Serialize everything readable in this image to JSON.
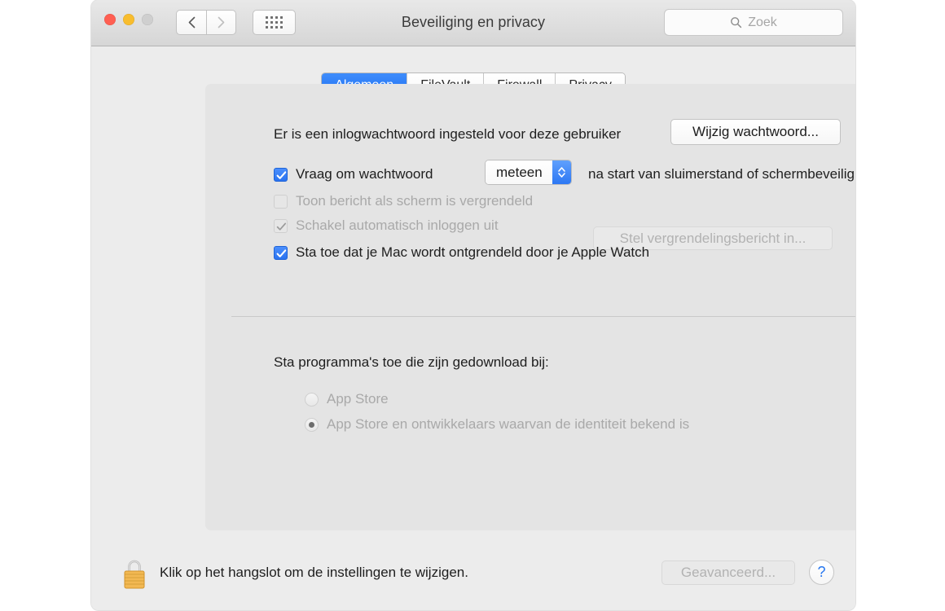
{
  "window": {
    "title": "Beveiliging en privacy",
    "traffic_lights": {
      "close_color": "#ff5f52",
      "minimize_color": "#f8bd2e",
      "zoom_color": "#cfcfcf"
    },
    "nav": {
      "back_icon": "chevron-left-icon",
      "forward_icon": "chevron-right-icon",
      "grid_icon": "grid-view-icon"
    },
    "search": {
      "placeholder": "Zoek",
      "value": "",
      "icon": "search-icon"
    }
  },
  "tabs": [
    {
      "label": "Algemeen",
      "active": true
    },
    {
      "label": "FileVault",
      "active": false
    },
    {
      "label": "Firewall",
      "active": false
    },
    {
      "label": "Privacy",
      "active": false
    }
  ],
  "general": {
    "password_status": "Er is een inlogwachtwoord ingesteld voor deze gebruiker",
    "change_password_button": "Wijzig wachtwoord...",
    "require_password": {
      "prefix": "Vraag om wachtwoord",
      "delay_value": "meteen",
      "suffix": "na start van sluimerstand of schermbeveiliging",
      "checked": true,
      "enabled": true
    },
    "show_message": {
      "label": "Toon bericht als scherm is vergrendeld",
      "checked": false,
      "enabled": false,
      "button": "Stel vergrendelingsbericht in..."
    },
    "disable_auto_login": {
      "label": "Schakel automatisch inloggen uit",
      "checked": true,
      "enabled": false
    },
    "apple_watch_unlock": {
      "label": "Sta toe dat je Mac wordt ontgrendeld door je Apple Watch",
      "checked": true,
      "enabled": true
    }
  },
  "downloads": {
    "heading": "Sta programma's toe die zijn gedownload bij:",
    "options": [
      {
        "label": "App Store",
        "selected": false,
        "enabled": false
      },
      {
        "label": "App Store en ontwikkelaars waarvan de identiteit bekend is",
        "selected": true,
        "enabled": false
      }
    ]
  },
  "footer": {
    "lock_icon": "closed-padlock-icon",
    "lock_text": "Klik op het hangslot om de instellingen te wijzigen.",
    "advanced_button": "Geavanceerd...",
    "help_button": "?"
  },
  "colors": {
    "accent_blue": "#2a73f0",
    "tab_active_blue": "#1d6ff2",
    "window_bg": "#ececec",
    "panel_bg": "#e4e4e4",
    "disabled_text": "#a9a9a9",
    "lock_gold": "#f0a93a"
  }
}
